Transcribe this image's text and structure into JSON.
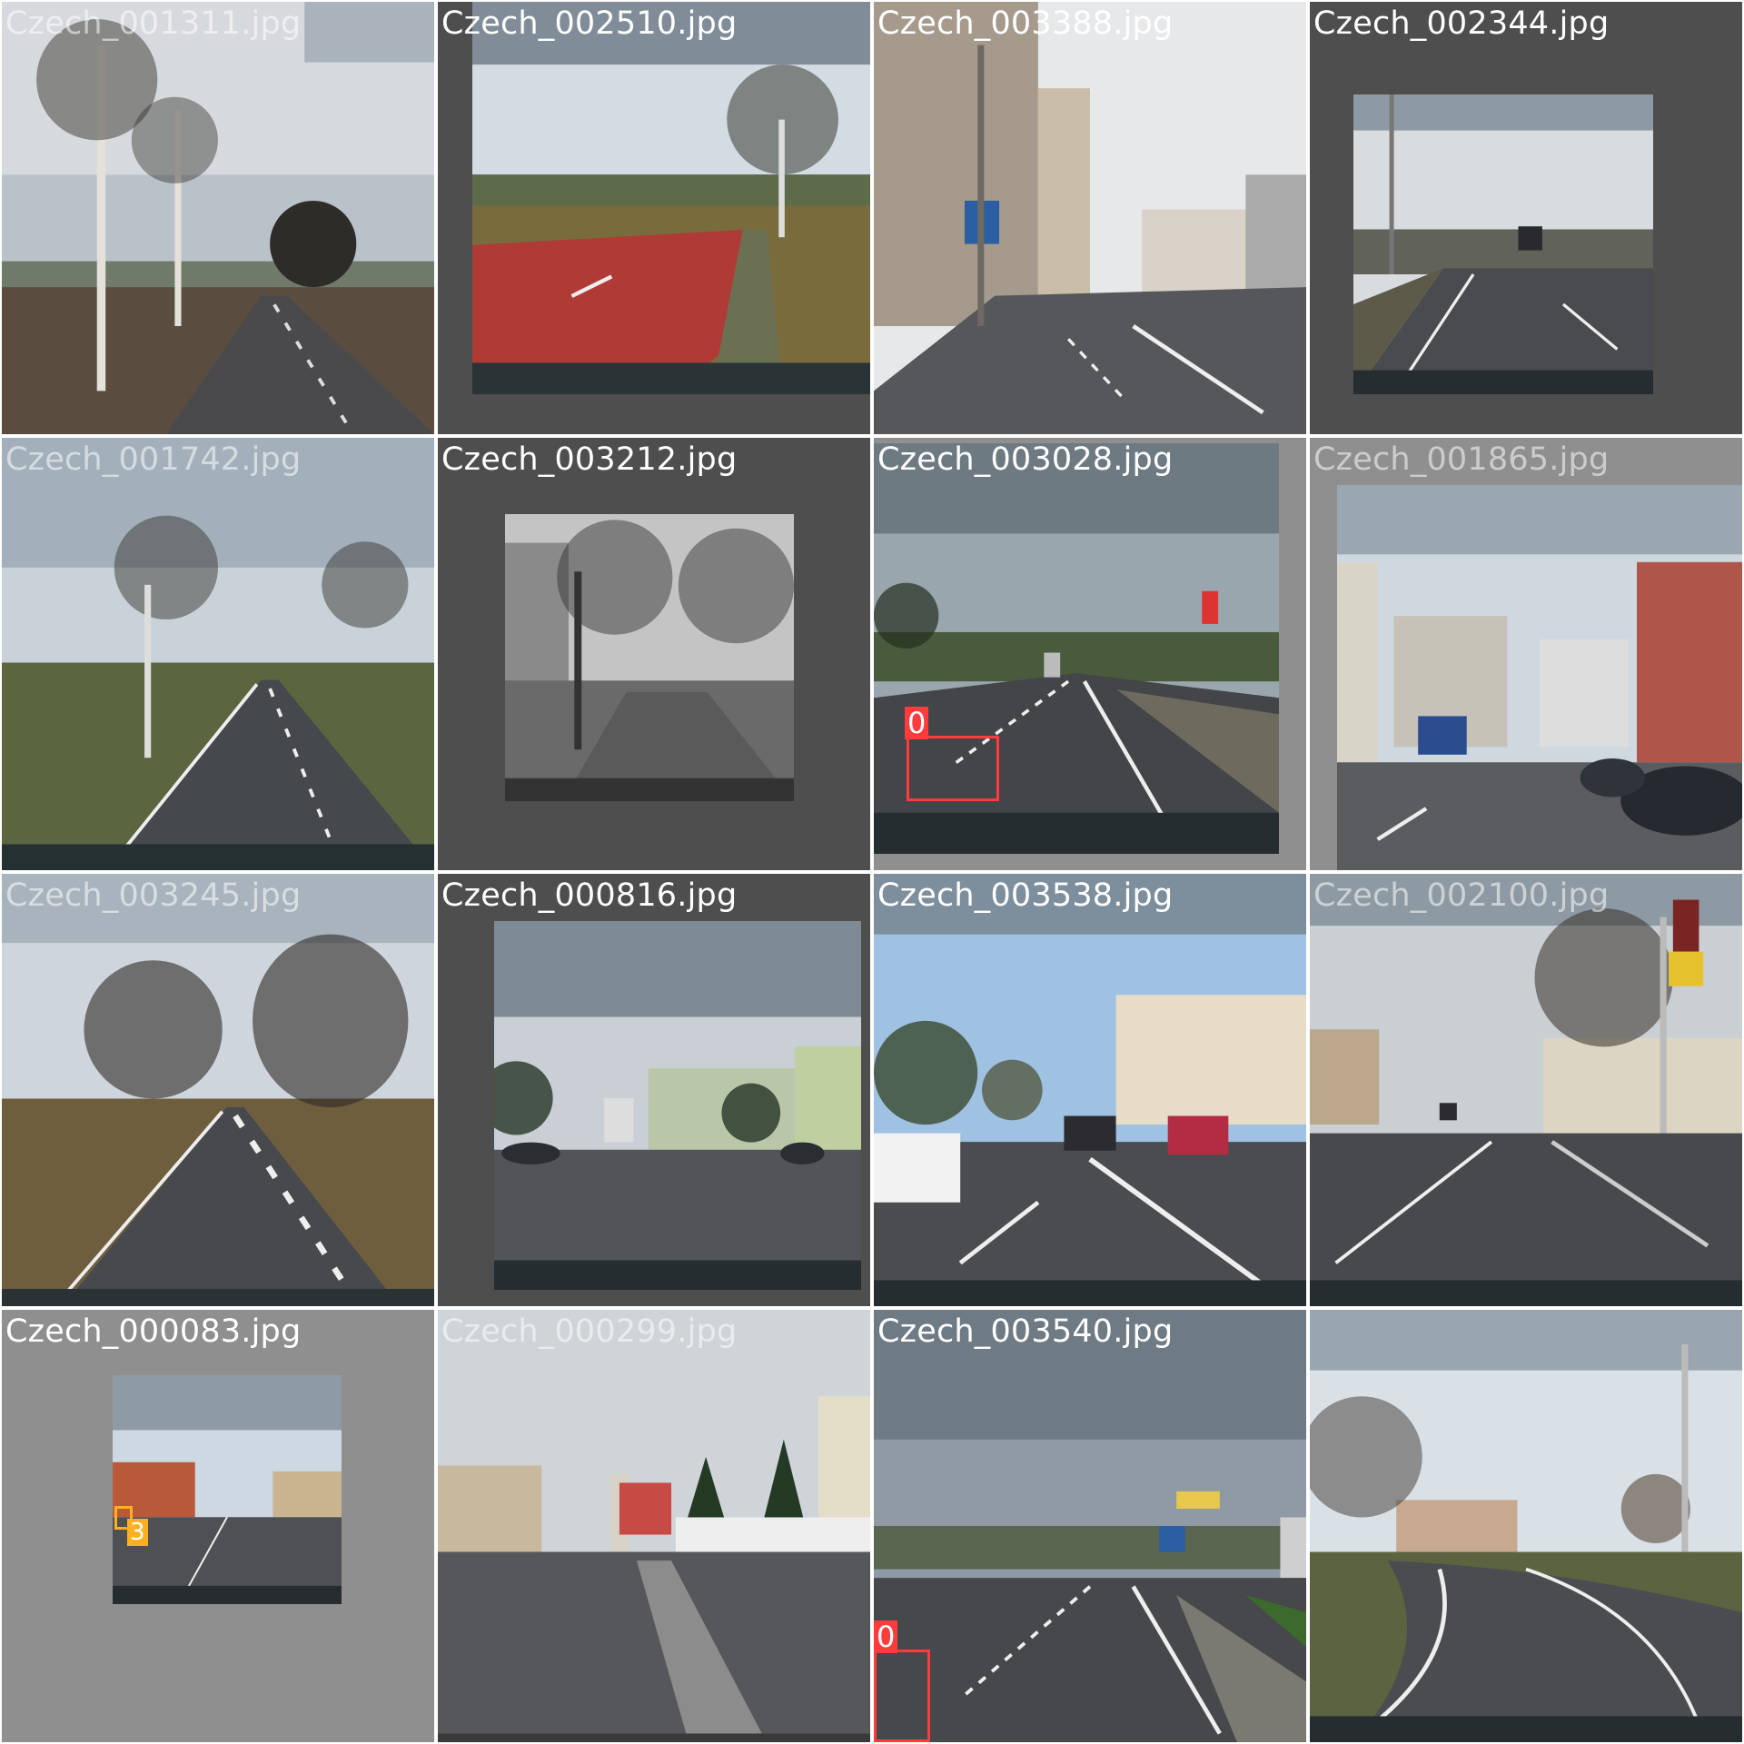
{
  "mosaic": {
    "tiles": [
      {
        "filename": "Czech_001311.jpg",
        "scene": "tree-lined rural road"
      },
      {
        "filename": "Czech_002510.jpg",
        "scene": "red bike lane curve"
      },
      {
        "filename": "Czech_003388.jpg",
        "scene": "city street with lane sign"
      },
      {
        "filename": "Czech_002344.jpg",
        "scene": "wide urban road"
      },
      {
        "filename": "Czech_001742.jpg",
        "scene": "rural road with birch trees"
      },
      {
        "filename": "Czech_003212.jpg",
        "scene": "grayscale residential street"
      },
      {
        "filename": "Czech_003028.jpg",
        "scene": "suburban road with truck"
      },
      {
        "filename": "Czech_001865.jpg",
        "scene": "urban street with parked cars"
      },
      {
        "filename": "Czech_003245.jpg",
        "scene": "country road with large trees"
      },
      {
        "filename": "Czech_000816.jpg",
        "scene": "parking lot and apartment blocks"
      },
      {
        "filename": "Czech_003538.jpg",
        "scene": "sunny boulevard with traffic"
      },
      {
        "filename": "Czech_002100.jpg",
        "scene": "town road with BILLA sign"
      },
      {
        "filename": "Czech_000083.jpg",
        "scene": "small town street"
      },
      {
        "filename": "Czech_000299.jpg",
        "scene": "village road with church"
      },
      {
        "filename": "Czech_003540.jpg",
        "scene": "multi-lane road with signs"
      },
      {
        "filename": "",
        "scene": "curved road with white lines"
      }
    ],
    "detections": {
      "czech_003028": {
        "class_label": "0"
      },
      "czech_000083": {
        "class_label": "3"
      },
      "czech_003540": {
        "class_label": "0"
      }
    },
    "colors": {
      "box_red": "#ff3b3b",
      "box_orange": "#ffb020",
      "pad_dark": "#4e4e4e",
      "pad_light": "#8f8f8f"
    }
  }
}
